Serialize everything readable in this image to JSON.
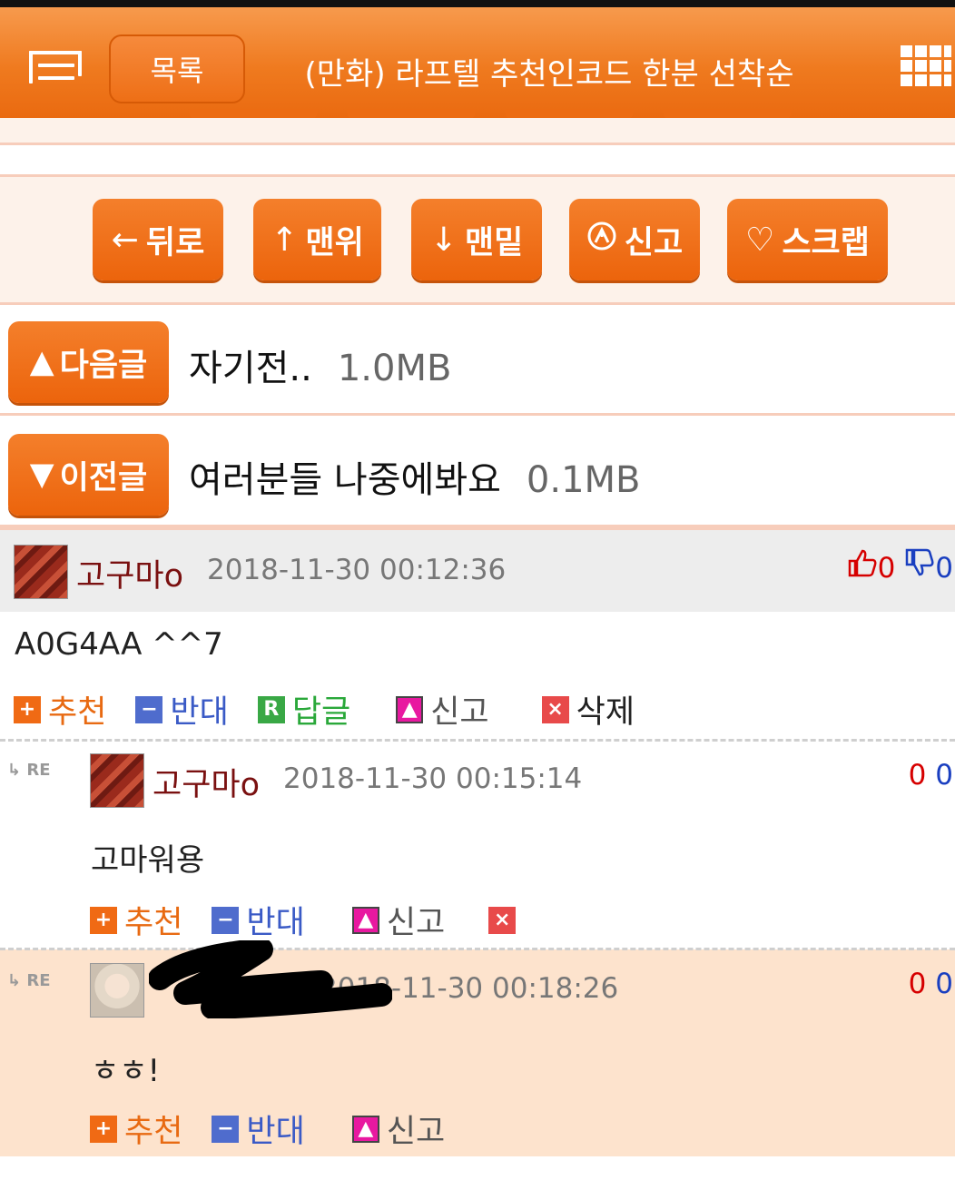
{
  "header": {
    "list_button": "목록",
    "title": "(만화) 라프텔 추천인코드 한분 선착순"
  },
  "nav": {
    "back": "뒤로",
    "top": "맨위",
    "bottom": "맨밑",
    "report": "신고",
    "scrap": "스크랩"
  },
  "next_post": {
    "label": "다음글",
    "title": "자기전..",
    "size": "1.0MB"
  },
  "prev_post": {
    "label": "이전글",
    "title": "여러분들 나중에봐요",
    "size": "0.1MB"
  },
  "comments": [
    {
      "nick": "고구마o",
      "time": "2018-11-30 00:12:36",
      "up": "0",
      "down": "0",
      "text": "A0G4AA ^^7",
      "actions": {
        "recommend": "추천",
        "oppose": "반대",
        "reply": "답글",
        "report": "신고",
        "delete": "삭제"
      }
    },
    {
      "re": "RE",
      "nick": "고구마o",
      "time": "2018-11-30 00:15:14",
      "up": "0",
      "down": "0",
      "text": "고마워용",
      "actions": {
        "recommend": "추천",
        "oppose": "반대",
        "report": "신고"
      }
    },
    {
      "re": "RE",
      "time": "2018-11-30 00:18:26",
      "up": "0",
      "down": "0",
      "text": "ㅎㅎ!",
      "actions": {
        "recommend": "추천",
        "oppose": "반대",
        "report": "신고"
      }
    }
  ],
  "colors": {
    "accent": "#ee6f16",
    "soft_bg": "#fdf2ea",
    "reply_bg": "#fde3cd"
  }
}
